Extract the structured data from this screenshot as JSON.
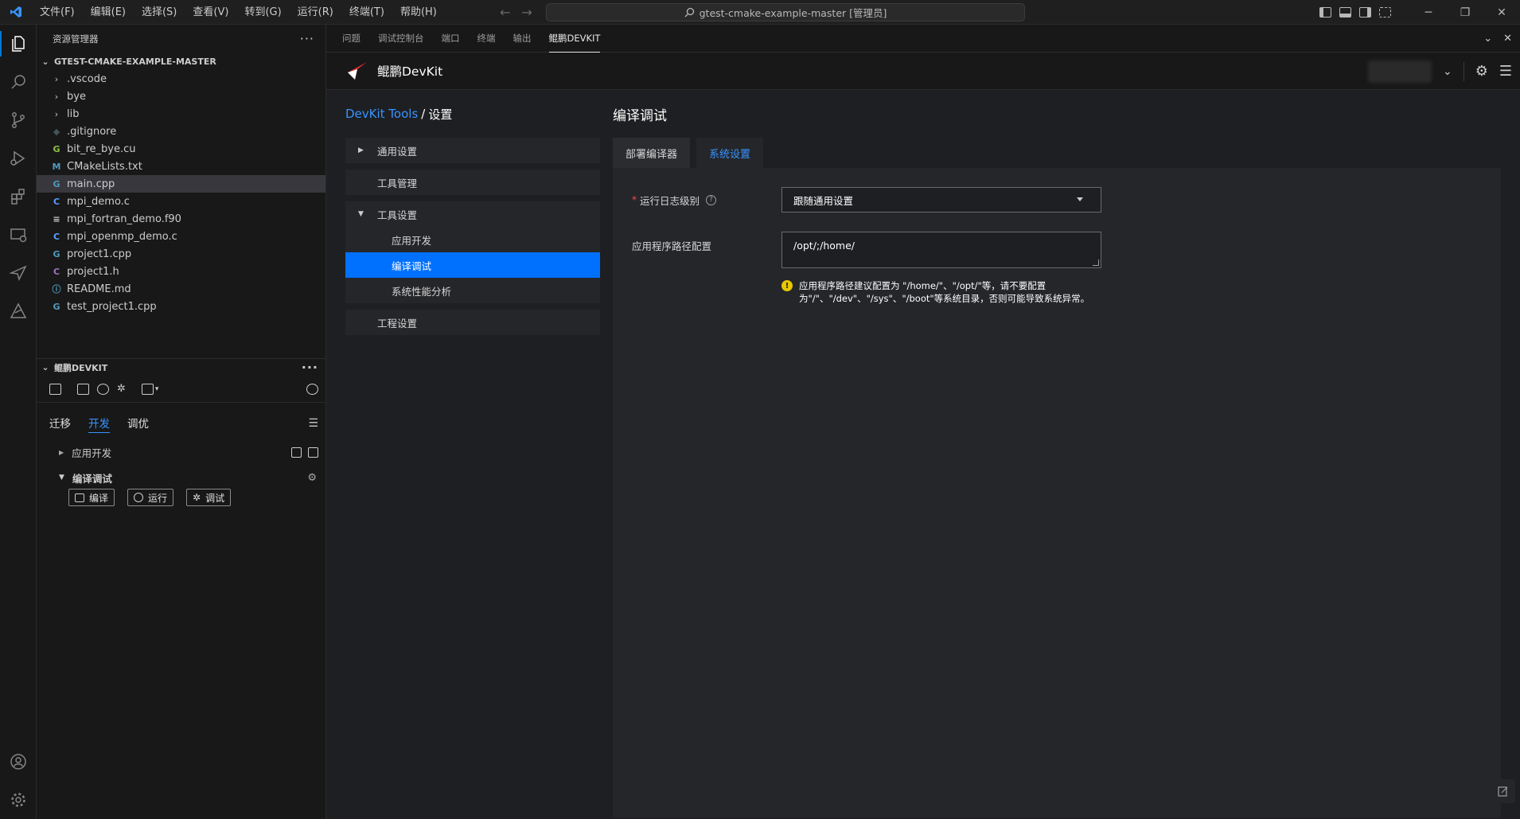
{
  "titlebar": {
    "menus": [
      "文件(F)",
      "编辑(E)",
      "选择(S)",
      "查看(V)",
      "转到(G)",
      "运行(R)",
      "终端(T)",
      "帮助(H)"
    ],
    "search_text": "gtest-cmake-example-master [管理员]"
  },
  "explorer": {
    "header": "资源管理器",
    "root": "GTEST-CMAKE-EXAMPLE-MASTER",
    "folders": [
      ".vscode",
      "bye",
      "lib"
    ],
    "files": [
      {
        "name": ".gitignore",
        "icon": "git-icon"
      },
      {
        "name": "bit_re_bye.cu",
        "icon": "cuda-icon"
      },
      {
        "name": "CMakeLists.txt",
        "icon": "cmake-icon"
      },
      {
        "name": "main.cpp",
        "icon": "cpp-icon"
      },
      {
        "name": "mpi_demo.c",
        "icon": "c-icon"
      },
      {
        "name": "mpi_fortran_demo.f90",
        "icon": "fortran-icon"
      },
      {
        "name": "mpi_openmp_demo.c",
        "icon": "c-icon"
      },
      {
        "name": "project1.cpp",
        "icon": "cpp-icon"
      },
      {
        "name": "project1.h",
        "icon": "h-icon"
      },
      {
        "name": "README.md",
        "icon": "info-icon"
      },
      {
        "name": "test_project1.cpp",
        "icon": "cpp-icon"
      }
    ],
    "selected": "main.cpp"
  },
  "devkit_side": {
    "header": "鲲鹏DEVKIT",
    "tabs": [
      "迁移",
      "开发",
      "调优"
    ],
    "active_tab": "开发",
    "app_dev": "应用开发",
    "compile_debug": "编译调试",
    "buttons": {
      "compile": "编译",
      "run": "运行",
      "debug": "调试"
    }
  },
  "panel": {
    "tabs": [
      "问题",
      "调试控制台",
      "端口",
      "终端",
      "输出",
      "鲲鹏DEVKIT"
    ],
    "active_tab": "鲲鹏DEVKIT"
  },
  "devkit_page": {
    "brand": "鲲鹏DevKit",
    "breadcrumb_link": "DevKit Tools",
    "breadcrumb_sep": " / ",
    "breadcrumb_current": "设置",
    "nav": {
      "general": "通用设置",
      "tool_mgmt": "工具管理",
      "tool_settings": "工具设置",
      "sub_app_dev": "应用开发",
      "sub_compile": "编译调试",
      "sub_perf": "系统性能分析",
      "project": "工程设置"
    },
    "title": "编译调试",
    "tabs": [
      "部署编译器",
      "系统设置"
    ],
    "active_tab": "系统设置",
    "log_level_label": "运行日志级别",
    "log_level_value": "跟随通用设置",
    "path_label": "应用程序路径配置",
    "path_value": "/opt/;/home/",
    "warning_line1": "应用程序路径建议配置为 \"/home/\"、\"/opt/\"等，请不要配置",
    "warning_line2": "为\"/\"、\"/dev\"、\"/sys\"、\"/boot\"等系统目录，否则可能导致系统异常。"
  },
  "colors": {
    "accent": "#0071ff",
    "link": "#3794ff",
    "required": "#f14c4c",
    "warning": "#e6c700"
  }
}
